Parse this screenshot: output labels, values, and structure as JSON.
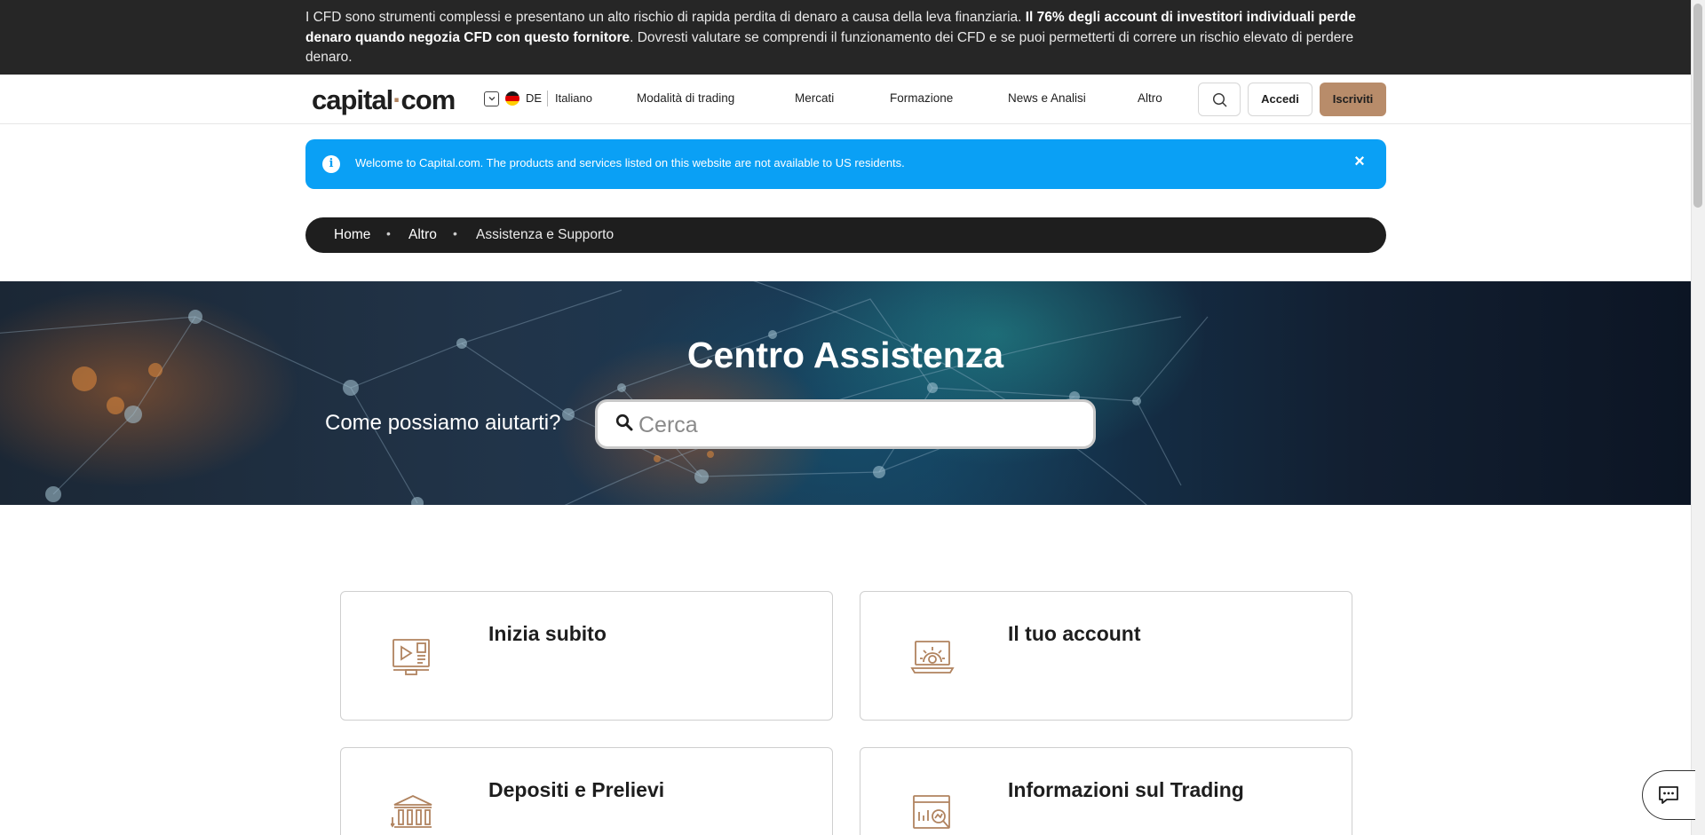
{
  "risk_banner": {
    "text_before": "I CFD sono strumenti complessi e presentano un alto rischio di rapida perdita di denaro a causa della leva finanziaria. ",
    "text_bold": "Il 76% degli account di investitori individuali perde denaro quando negozia CFD con questo fornitore",
    "text_after": ". Dovresti valutare se comprendi il funzionamento dei CFD e se puoi permetterti di correre un rischio elevato di perdere denaro."
  },
  "header": {
    "logo_left": "capital",
    "logo_dot": "·",
    "logo_right": "com",
    "language_code": "DE",
    "language_name": "Italiano",
    "nav": [
      "Modalità di trading",
      "Mercati",
      "Formazione",
      "News e Analisi",
      "Altro"
    ],
    "search_icon": "search-icon",
    "login_label": "Accedi",
    "signup_label": "Iscriviti",
    "colors": {
      "accent": "#b88c6a",
      "dark": "#1e1e1e"
    }
  },
  "alert": {
    "icon": "info-icon",
    "text": "Welcome to Capital.com. The products and services listed on this website are not available to US residents.",
    "close": "×",
    "color": "#0aa0f5"
  },
  "breadcrumb": {
    "items": [
      "Home",
      "Altro",
      "Assistenza e Supporto"
    ],
    "separator": "•"
  },
  "hero": {
    "title": "Centro Assistenza",
    "question": "Come possiamo aiutarti?",
    "search_placeholder": "Cerca"
  },
  "cards": [
    {
      "title": "Inizia subito",
      "icon": "monitor-play-icon"
    },
    {
      "title": "Il tuo account",
      "icon": "laptop-gear-icon"
    },
    {
      "title": "Depositi e Prelievi",
      "icon": "bank-transfer-icon"
    },
    {
      "title": "Informazioni sul Trading",
      "icon": "chart-magnifier-icon"
    }
  ],
  "chat": {
    "icon": "chat-icon"
  }
}
